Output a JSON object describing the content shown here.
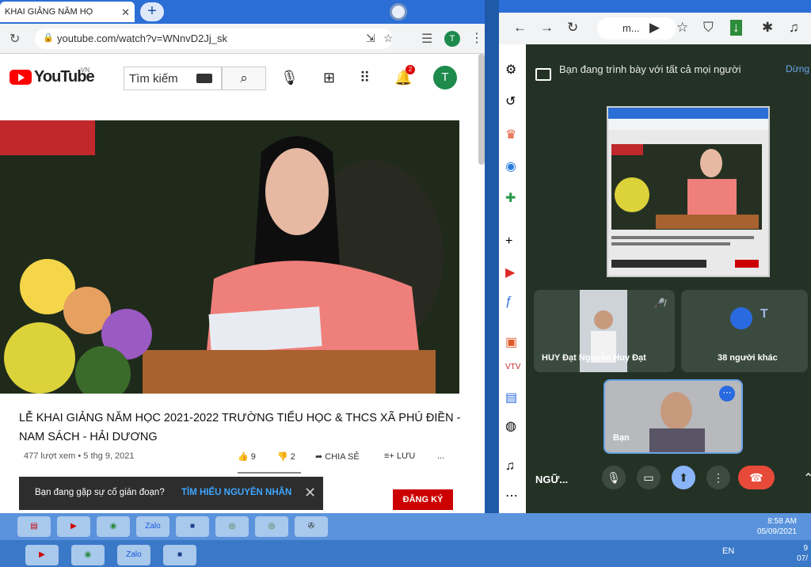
{
  "left_browser": {
    "tab_title": "KHAI GIẢNG NĂM HỌ",
    "url": "youtube.com/watch?v=WNnvD2Jj_sk",
    "profile_initial": "T"
  },
  "youtube": {
    "brand": "YouTube",
    "region": "VN",
    "search_placeholder": "Tìm kiếm",
    "notification_count": "2",
    "avatar_initial": "T",
    "video_title": "LỄ KHAI GIẢNG NĂM HỌC 2021-2022 TRƯỜNG TIỂU HỌC & THCS XÃ PHÚ ĐIỀN - NAM SÁCH - HẢI DƯƠNG",
    "views": "477 lượt xem",
    "date": "5 thg 9, 2021",
    "likes": "9",
    "dislikes": "2",
    "share_label": "CHIA SẺ",
    "save_label": "LƯU",
    "more_label": "...",
    "toast_text": "Bạn đang gặp sự cố gián đoạn?",
    "toast_link": "TÌM HIỂU NGUYÊN NHÂN",
    "subscribe_label": "ĐĂNG KÝ"
  },
  "right_browser": {
    "url_short": "m...",
    "present_text": "Bạn đang trình bày với tất cả mọi người",
    "stop_present_partial": "Dừng",
    "tiles": [
      {
        "name": "HUY Đạt Nguyễn Huy Đạt"
      },
      {
        "name": "38 người khác",
        "initial": "T"
      },
      {
        "name": "Bạn"
      }
    ],
    "meeting_code": "NGỮ..."
  },
  "taskbar": {
    "time": "8:58 AM",
    "date": "05/09/2021",
    "lang": "EN",
    "apps": [
      "Zalo",
      "Zalo"
    ],
    "bottom_time_partial": "9",
    "bottom_date_partial": "07/"
  }
}
